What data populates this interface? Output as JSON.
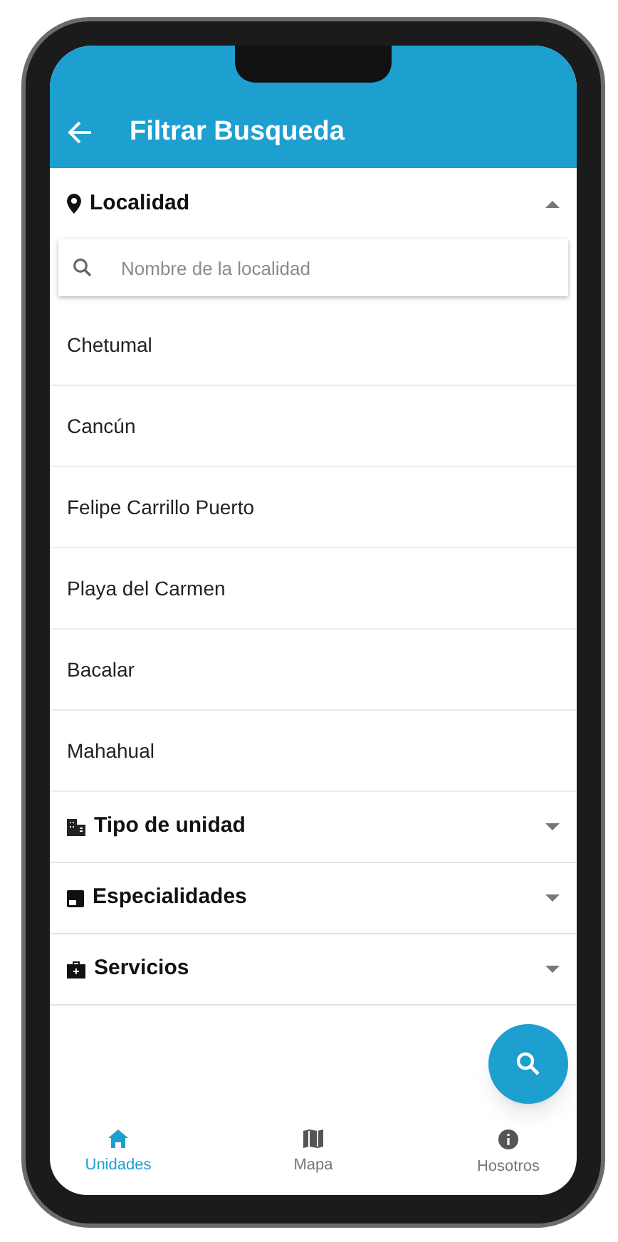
{
  "app_bar": {
    "title": "Filtrar Busqueda"
  },
  "sections": [
    {
      "label": "Localidad",
      "expanded": true,
      "search": {
        "placeholder": "Nombre de la localidad"
      },
      "items": [
        "Chetumal",
        "Cancún",
        "Felipe Carrillo Puerto",
        "Playa del Carmen",
        "Bacalar",
        "Mahahual"
      ]
    },
    {
      "label": "Tipo de unidad",
      "expanded": false
    },
    {
      "label": "Especialidades",
      "expanded": false
    },
    {
      "label": "Servicios",
      "expanded": false
    }
  ],
  "bottom_nav": [
    {
      "label": "Unidades",
      "selected": true
    },
    {
      "label": "Mapa",
      "selected": false
    },
    {
      "label": "Hosotros",
      "selected": false
    }
  ]
}
